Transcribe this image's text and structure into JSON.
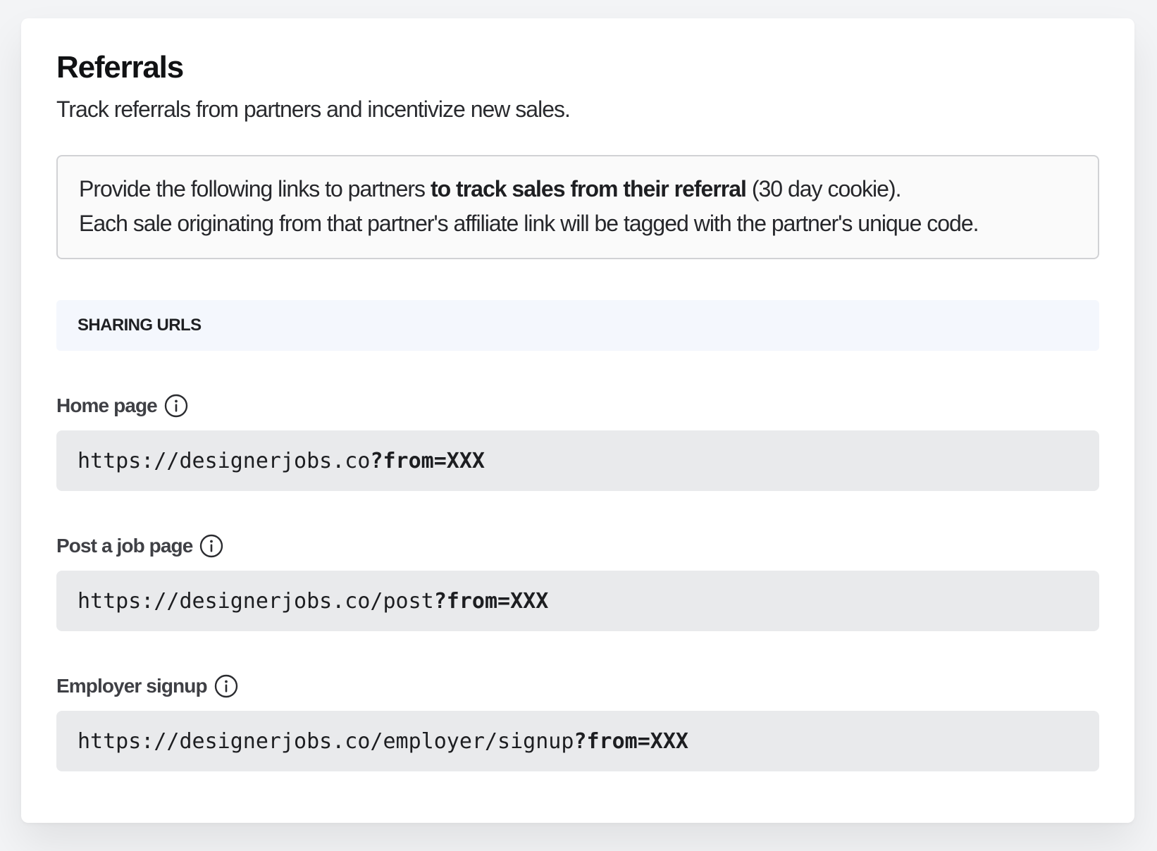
{
  "header": {
    "title": "Referrals",
    "subtitle": "Track referrals from partners and incentivize new sales."
  },
  "notice": {
    "line1_prefix": "Provide the following links to partners ",
    "line1_bold": "to track sales from their referral",
    "line1_suffix": " (30 day cookie).",
    "line2": "Each sale originating from that partner's affiliate link will be tagged with the partner's unique code."
  },
  "section": {
    "title": "SHARING URLS"
  },
  "urls": [
    {
      "label": "Home page",
      "icon": "info-icon",
      "base": "https://designerjobs.co",
      "param": "?from=XXX"
    },
    {
      "label": "Post a job page",
      "icon": "info-icon",
      "base": "https://designerjobs.co/post",
      "param": "?from=XXX"
    },
    {
      "label": "Employer signup",
      "icon": "info-icon",
      "base": "https://designerjobs.co/employer/signup",
      "param": "?from=XXX"
    }
  ]
}
